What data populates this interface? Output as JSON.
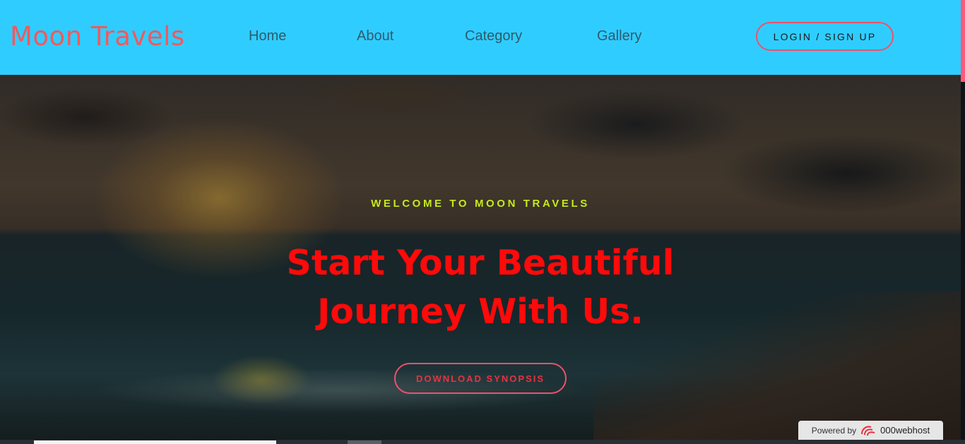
{
  "header": {
    "logo": "Moon Travels",
    "nav": [
      "Home",
      "About",
      "Category",
      "Gallery"
    ],
    "login_label": "LOGIN / SIGN UP"
  },
  "hero": {
    "kicker": "WELCOME TO MOON TRAVELS",
    "headline_line1": "Start Your Beautiful",
    "headline_line2": "Journey With Us.",
    "cta_label": "DOWNLOAD SYNOPSIS"
  },
  "footer_badge": {
    "powered_by": "Powered by",
    "host_name": "000webhost",
    "host_icon": "000webhost-logo-icon"
  },
  "colors": {
    "nav_background": "#2fcdff",
    "logo": "#f05a5f",
    "kicker": "#c4ea1a",
    "headline": "#ff0a0a",
    "button_border": "#f0506e"
  }
}
